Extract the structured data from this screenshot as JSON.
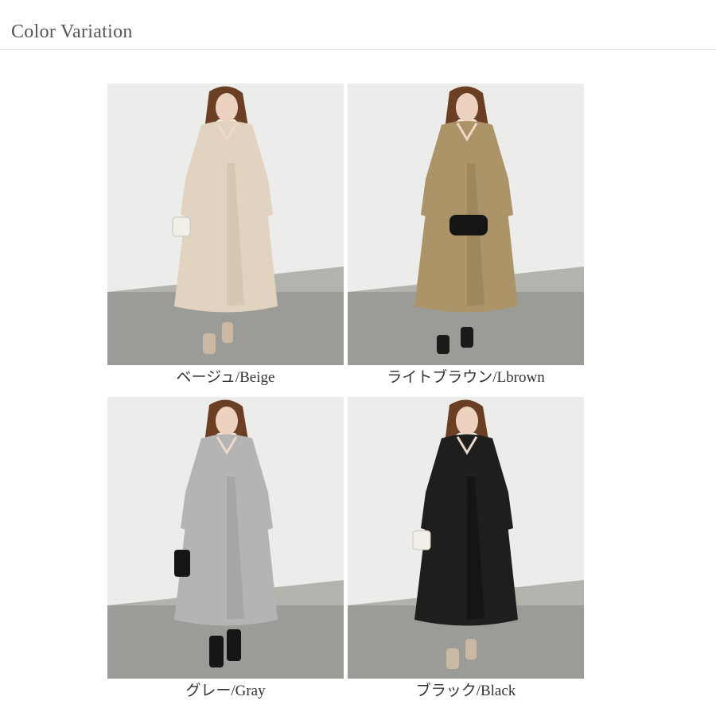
{
  "header": {
    "title": "Color Variation"
  },
  "variants": [
    {
      "label": "ベージュ/Beige",
      "dress_color": "#e2d3c1",
      "dress_shade": "#cdbba6",
      "bag": "white-bag",
      "shoes_color": "#cbb8a3"
    },
    {
      "label": "ライトブラウン/Lbrown",
      "dress_color": "#ab9468",
      "dress_shade": "#927b52",
      "bag": "black-bag",
      "shoes_color": "#1a1a1a"
    },
    {
      "label": "グレー/Gray",
      "dress_color": "#b4b4b4",
      "dress_shade": "#9a9a9a",
      "bag": "black-bag",
      "shoes_color": "#151515"
    },
    {
      "label": "ブラック/Black",
      "dress_color": "#1e1e1e",
      "dress_shade": "#0f0f0f",
      "bag": "white-bag",
      "shoes_color": "#cbb8a3"
    }
  ]
}
